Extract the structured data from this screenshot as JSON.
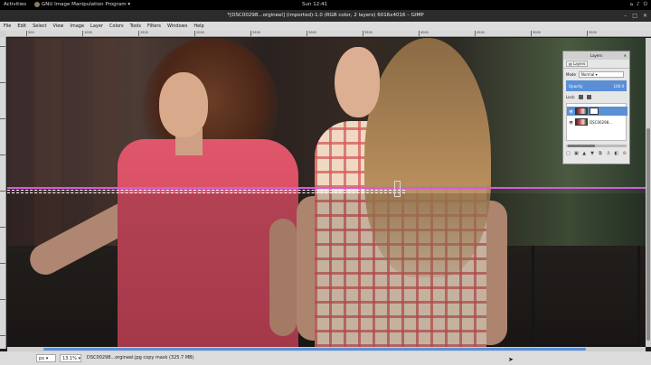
{
  "topbar": {
    "activities": "Activities",
    "app_name": "GNU Image Manipulation Program ▾",
    "clock": "Sun 12:41",
    "tray_icons": [
      "network-icon",
      "volume-icon",
      "power-icon"
    ]
  },
  "window": {
    "title": "*[DSC00298...orgineel] (imported)-1.0 (RGB color, 2 layers) 6016x4016 – GIMP"
  },
  "menu": {
    "file": "File",
    "edit": "Edit",
    "select": "Select",
    "view": "View",
    "image": "Image",
    "layer": "Layer",
    "colors": "Colors",
    "tools": "Tools",
    "filters": "Filters",
    "windows": "Windows",
    "help": "Help"
  },
  "ruler": {
    "labels": [
      "500",
      "1000",
      "1500",
      "2000",
      "2500",
      "3000",
      "3500",
      "4000",
      "4500",
      "5000",
      "5500"
    ]
  },
  "status": {
    "unit": "px ▾",
    "zoom": "13.1% ▾",
    "message": "DSC00298...orgineel.jpg copy mask (325.7 MB)"
  },
  "layers_dialog": {
    "title": "Layers",
    "tab_label": "Layers",
    "mode_label": "Mode",
    "mode_value": "Normal ▾",
    "opacity_label": "Opacity",
    "opacity_value": "100.0",
    "lock_label": "Lock:",
    "layer_1_name": "",
    "layer_2_name": "DSC00298..."
  },
  "colors": {
    "guide": "#d65ae0",
    "selection_accent": "#5a8fd6"
  }
}
